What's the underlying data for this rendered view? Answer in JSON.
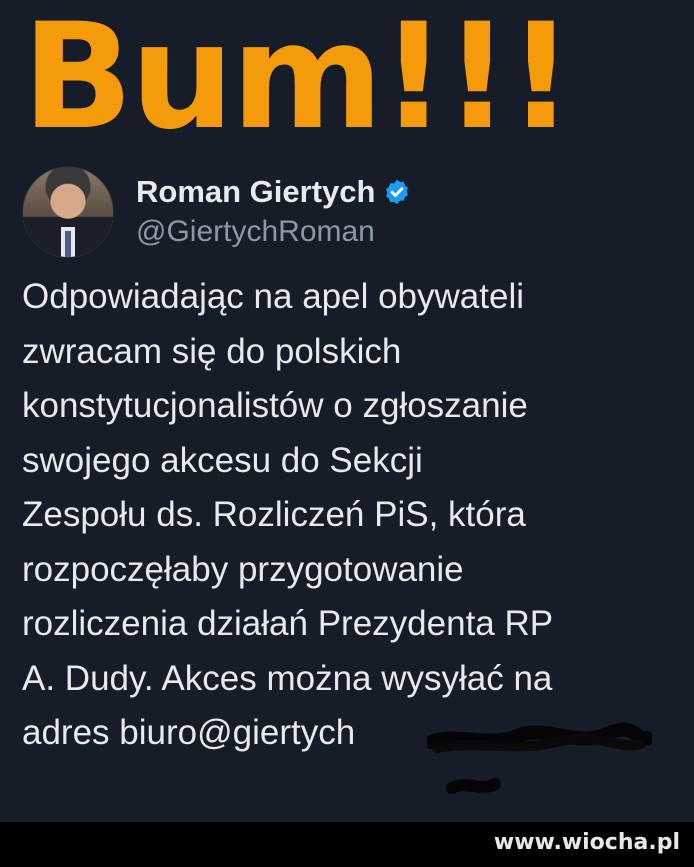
{
  "banner": {
    "text": "Bum!!!"
  },
  "tweet": {
    "author": {
      "display_name": "Roman Giertych",
      "handle": "@GiertychRoman",
      "verified": true,
      "avatar_icon": "person-photo-avatar",
      "verified_icon": "verified-badge-icon"
    },
    "lines": [
      "Odpowiadając na apel obywateli",
      "zwracam się do polskich",
      "konstytucjonalistów o zgłoszanie",
      "swojego akcesu do Sekcji",
      "Zespołu ds. Rozliczeń PiS, która",
      "rozpoczęłaby przygotowanie",
      "rozliczenia działań Prezydenta RP",
      "A. Dudy. Akces można wysyłać na",
      "adres biuro@giertych"
    ]
  },
  "footer": {
    "watermark": "www.wiocha.pl"
  },
  "colors": {
    "background": "#161d28",
    "banner": "#f59a0b",
    "verified": "#1d9bf0",
    "handle": "#8b98a5",
    "text": "#e7e9ea"
  }
}
